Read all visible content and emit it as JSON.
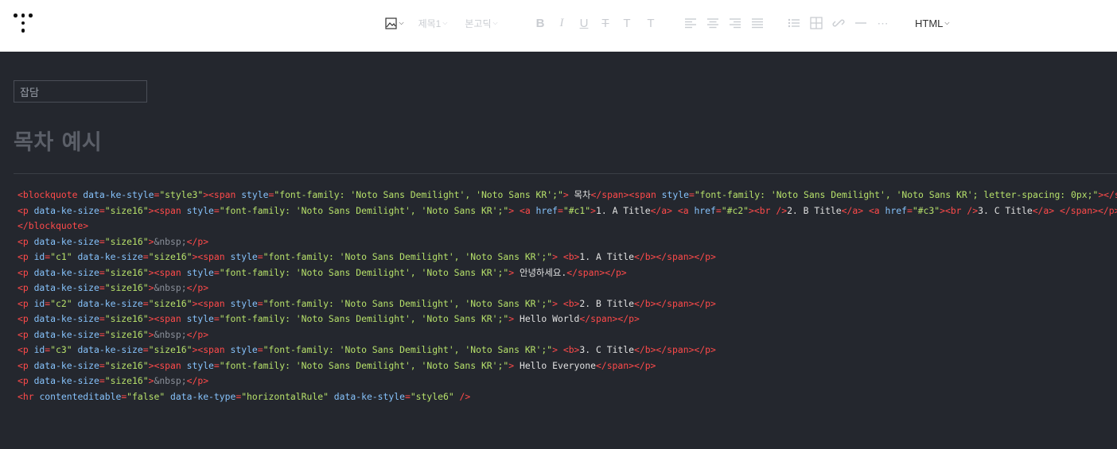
{
  "toolbar": {
    "heading_label": "제목1",
    "font_label": "본고딕",
    "html_mode_label": "HTML",
    "format_icons": [
      "bold-icon",
      "italic-icon",
      "underline-icon",
      "strikethrough-icon",
      "text-color-icon",
      "bg-color-icon"
    ],
    "align_icons": [
      "align-left-icon",
      "align-center-icon",
      "align-right-icon",
      "align-justify-icon"
    ],
    "insert_icons": [
      "list-icon",
      "table-icon",
      "link-icon",
      "horizontal-rule-icon",
      "more-icon"
    ]
  },
  "editor": {
    "category": "잡담",
    "title": "목차 예시"
  },
  "colors": {
    "background": "#24272e",
    "tag": "#ff4a4a",
    "attribute": "#86c2fb",
    "value": "#b6e06a",
    "text": "#e0e0e0"
  },
  "code_lines": [
    [
      [
        "t",
        "<blockquote "
      ],
      [
        "a",
        "data-ke-style"
      ],
      [
        "t",
        "="
      ],
      [
        "v",
        "\"style3\""
      ],
      [
        "t",
        "><span "
      ],
      [
        "a",
        "style"
      ],
      [
        "t",
        "="
      ],
      [
        "v",
        "\"font-family: 'Noto Sans Demilight', 'Noto Sans KR';\""
      ],
      [
        "t",
        ">"
      ],
      [
        "tx",
        " 목차"
      ],
      [
        "t",
        "</span><span "
      ],
      [
        "a",
        "style"
      ],
      [
        "t",
        "="
      ],
      [
        "v",
        "\"font-family: 'Noto Sans Demilight', 'Noto Sans KR'; letter-spacing: 0px;\""
      ],
      [
        "t",
        "></span>"
      ]
    ],
    [
      [
        "t",
        "<p "
      ],
      [
        "a",
        "data-ke-size"
      ],
      [
        "t",
        "="
      ],
      [
        "v",
        "\"size16\""
      ],
      [
        "t",
        "><span "
      ],
      [
        "a",
        "style"
      ],
      [
        "t",
        "="
      ],
      [
        "v",
        "\"font-family: 'Noto Sans Demilight', 'Noto Sans KR';\""
      ],
      [
        "t",
        ">"
      ],
      [
        "tx",
        " "
      ],
      [
        "t",
        "<a "
      ],
      [
        "a",
        "href"
      ],
      [
        "t",
        "="
      ],
      [
        "v",
        "\"#c1\""
      ],
      [
        "t",
        ">"
      ],
      [
        "tx",
        "1. A Title"
      ],
      [
        "t",
        "</a>"
      ],
      [
        "tx",
        " "
      ],
      [
        "t",
        "<a "
      ],
      [
        "a",
        "href"
      ],
      [
        "t",
        "="
      ],
      [
        "v",
        "\"#c2\""
      ],
      [
        "t",
        "><br />"
      ],
      [
        "tx",
        "2. B Title"
      ],
      [
        "t",
        "</a>"
      ],
      [
        "tx",
        " "
      ],
      [
        "t",
        "<a "
      ],
      [
        "a",
        "href"
      ],
      [
        "t",
        "="
      ],
      [
        "v",
        "\"#c3\""
      ],
      [
        "t",
        "><br />"
      ],
      [
        "tx",
        "3. C Title"
      ],
      [
        "t",
        "</a>"
      ],
      [
        "tx",
        " "
      ],
      [
        "t",
        "</span></p>"
      ]
    ],
    [
      [
        "t",
        "</blockquote>"
      ]
    ],
    [
      [
        "t",
        "<p "
      ],
      [
        "a",
        "data-ke-size"
      ],
      [
        "t",
        "="
      ],
      [
        "v",
        "\"size16\""
      ],
      [
        "t",
        ">"
      ],
      [
        "e",
        "&nbsp;"
      ],
      [
        "t",
        "</p>"
      ]
    ],
    [
      [
        "t",
        "<p "
      ],
      [
        "a",
        "id"
      ],
      [
        "t",
        "="
      ],
      [
        "v",
        "\"c1\""
      ],
      [
        "tx",
        " "
      ],
      [
        "a",
        "data-ke-size"
      ],
      [
        "t",
        "="
      ],
      [
        "v",
        "\"size16\""
      ],
      [
        "t",
        "><span "
      ],
      [
        "a",
        "style"
      ],
      [
        "t",
        "="
      ],
      [
        "v",
        "\"font-family: 'Noto Sans Demilight', 'Noto Sans KR';\""
      ],
      [
        "t",
        ">"
      ],
      [
        "tx",
        " "
      ],
      [
        "t",
        "<b>"
      ],
      [
        "tx",
        "1. A Title"
      ],
      [
        "t",
        "</b></span></p>"
      ]
    ],
    [
      [
        "t",
        "<p "
      ],
      [
        "a",
        "data-ke-size"
      ],
      [
        "t",
        "="
      ],
      [
        "v",
        "\"size16\""
      ],
      [
        "t",
        "><span "
      ],
      [
        "a",
        "style"
      ],
      [
        "t",
        "="
      ],
      [
        "v",
        "\"font-family: 'Noto Sans Demilight', 'Noto Sans KR';\""
      ],
      [
        "t",
        ">"
      ],
      [
        "tx",
        " 안녕하세요."
      ],
      [
        "t",
        "</span></p>"
      ]
    ],
    [
      [
        "t",
        "<p "
      ],
      [
        "a",
        "data-ke-size"
      ],
      [
        "t",
        "="
      ],
      [
        "v",
        "\"size16\""
      ],
      [
        "t",
        ">"
      ],
      [
        "e",
        "&nbsp;"
      ],
      [
        "t",
        "</p>"
      ]
    ],
    [
      [
        "t",
        "<p "
      ],
      [
        "a",
        "id"
      ],
      [
        "t",
        "="
      ],
      [
        "v",
        "\"c2\""
      ],
      [
        "tx",
        " "
      ],
      [
        "a",
        "data-ke-size"
      ],
      [
        "t",
        "="
      ],
      [
        "v",
        "\"size16\""
      ],
      [
        "t",
        "><span "
      ],
      [
        "a",
        "style"
      ],
      [
        "t",
        "="
      ],
      [
        "v",
        "\"font-family: 'Noto Sans Demilight', 'Noto Sans KR';\""
      ],
      [
        "t",
        ">"
      ],
      [
        "tx",
        " "
      ],
      [
        "t",
        "<b>"
      ],
      [
        "tx",
        "2. B Title"
      ],
      [
        "t",
        "</b></span></p>"
      ]
    ],
    [
      [
        "t",
        "<p "
      ],
      [
        "a",
        "data-ke-size"
      ],
      [
        "t",
        "="
      ],
      [
        "v",
        "\"size16\""
      ],
      [
        "t",
        "><span "
      ],
      [
        "a",
        "style"
      ],
      [
        "t",
        "="
      ],
      [
        "v",
        "\"font-family: 'Noto Sans Demilight', 'Noto Sans KR';\""
      ],
      [
        "t",
        ">"
      ],
      [
        "tx",
        " Hello World"
      ],
      [
        "t",
        "</span></p>"
      ]
    ],
    [
      [
        "t",
        "<p "
      ],
      [
        "a",
        "data-ke-size"
      ],
      [
        "t",
        "="
      ],
      [
        "v",
        "\"size16\""
      ],
      [
        "t",
        ">"
      ],
      [
        "e",
        "&nbsp;"
      ],
      [
        "t",
        "</p>"
      ]
    ],
    [
      [
        "t",
        "<p "
      ],
      [
        "a",
        "id"
      ],
      [
        "t",
        "="
      ],
      [
        "v",
        "\"c3\""
      ],
      [
        "tx",
        " "
      ],
      [
        "a",
        "data-ke-size"
      ],
      [
        "t",
        "="
      ],
      [
        "v",
        "\"size16\""
      ],
      [
        "t",
        "><span "
      ],
      [
        "a",
        "style"
      ],
      [
        "t",
        "="
      ],
      [
        "v",
        "\"font-family: 'Noto Sans Demilight', 'Noto Sans KR';\""
      ],
      [
        "t",
        ">"
      ],
      [
        "tx",
        " "
      ],
      [
        "t",
        "<b>"
      ],
      [
        "tx",
        "3. C Title"
      ],
      [
        "t",
        "</b></span></p>"
      ]
    ],
    [
      [
        "t",
        "<p "
      ],
      [
        "a",
        "data-ke-size"
      ],
      [
        "t",
        "="
      ],
      [
        "v",
        "\"size16\""
      ],
      [
        "t",
        "><span "
      ],
      [
        "a",
        "style"
      ],
      [
        "t",
        "="
      ],
      [
        "v",
        "\"font-family: 'Noto Sans Demilight', 'Noto Sans KR';\""
      ],
      [
        "t",
        ">"
      ],
      [
        "tx",
        " Hello Everyone"
      ],
      [
        "t",
        "</span></p>"
      ]
    ],
    [
      [
        "t",
        "<p "
      ],
      [
        "a",
        "data-ke-size"
      ],
      [
        "t",
        "="
      ],
      [
        "v",
        "\"size16\""
      ],
      [
        "t",
        ">"
      ],
      [
        "e",
        "&nbsp;"
      ],
      [
        "t",
        "</p>"
      ]
    ],
    [
      [
        "t",
        "<hr "
      ],
      [
        "a",
        "contenteditable"
      ],
      [
        "t",
        "="
      ],
      [
        "v",
        "\"false\""
      ],
      [
        "tx",
        " "
      ],
      [
        "a",
        "data-ke-type"
      ],
      [
        "t",
        "="
      ],
      [
        "v",
        "\"horizontalRule\""
      ],
      [
        "tx",
        " "
      ],
      [
        "a",
        "data-ke-style"
      ],
      [
        "t",
        "="
      ],
      [
        "v",
        "\"style6\""
      ],
      [
        "tx",
        " "
      ],
      [
        "t",
        "/>"
      ]
    ]
  ]
}
